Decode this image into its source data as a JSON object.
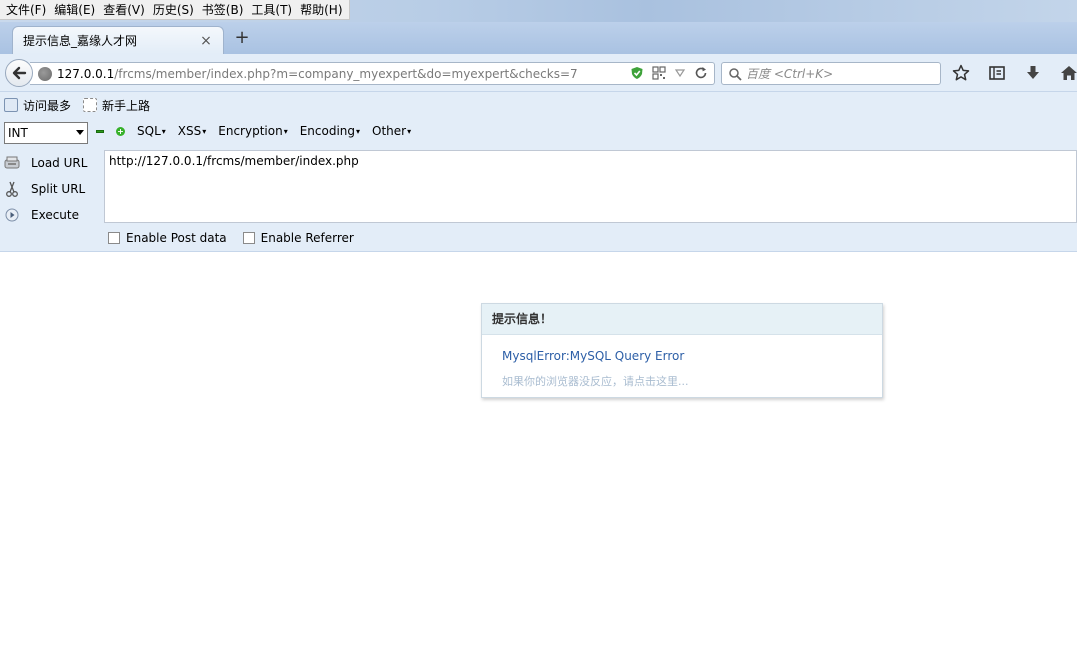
{
  "menubar": {
    "items": [
      "文件(F)",
      "编辑(E)",
      "查看(V)",
      "历史(S)",
      "书签(B)",
      "工具(T)",
      "帮助(H)"
    ]
  },
  "tab": {
    "title": "提示信息_嘉缘人才网",
    "close_glyph": "×",
    "new_tab_glyph": "+"
  },
  "urlbar": {
    "host": "127.0.0.1",
    "path": "/frcms/member/index.php?m=company_myexpert&do=myexpert&checks=7"
  },
  "search": {
    "placeholder": "百度 <Ctrl+K>"
  },
  "bookmarks": {
    "items": [
      "访问最多",
      "新手上路"
    ]
  },
  "hackbar": {
    "select_value": "INT",
    "menus": [
      "SQL",
      "XSS",
      "Encryption",
      "Encoding",
      "Other"
    ],
    "buttons": [
      "Load URL",
      "Split URL",
      "Execute"
    ],
    "url_value": "http://127.0.0.1/frcms/member/index.php",
    "checkboxes": [
      "Enable Post data",
      "Enable Referrer"
    ]
  },
  "message": {
    "title": "提示信息！",
    "error": "MysqlError:MySQL Query Error",
    "hint": "如果你的浏览器没反应，请点击这里..."
  }
}
